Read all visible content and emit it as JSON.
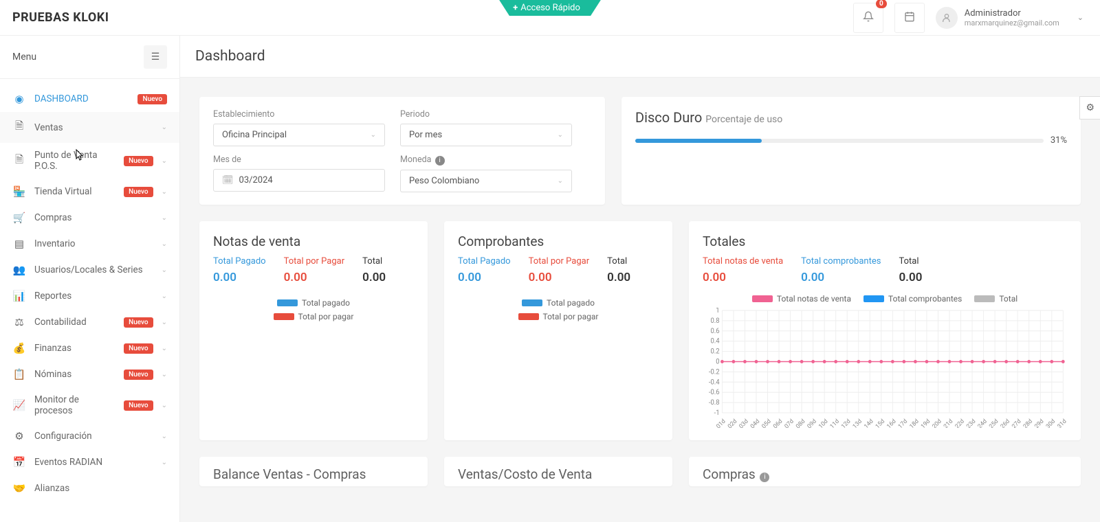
{
  "quick_access": "Acceso Rápido",
  "logo": "PRUEBAS KLOKI",
  "notifications_count": "0",
  "user": {
    "name": "Administrador",
    "email": "marxmarquinez@gmail.com"
  },
  "menu_label": "Menu",
  "page_title": "Dashboard",
  "badge_new": "Nuevo",
  "nav": {
    "dashboard": "DASHBOARD",
    "ventas": "Ventas",
    "pos": "Punto de Venta P.O.S.",
    "tienda": "Tienda Virtual",
    "compras": "Compras",
    "inventario": "Inventario",
    "usuarios": "Usuarios/Locales & Series",
    "reportes": "Reportes",
    "contabilidad": "Contabilidad",
    "finanzas": "Finanzas",
    "nominas": "Nóminas",
    "monitor": "Monitor de procesos",
    "config": "Configuración",
    "radian": "Eventos RADIAN",
    "alianzas": "Alianzas"
  },
  "filters": {
    "establecimiento_label": "Establecimiento",
    "establecimiento_value": "Oficina Principal",
    "periodo_label": "Periodo",
    "periodo_value": "Por mes",
    "mes_label": "Mes de",
    "mes_value": "03/2024",
    "moneda_label": "Moneda",
    "moneda_value": "Peso Colombiano"
  },
  "disk": {
    "title": "Disco Duro",
    "subtitle": "Porcentaje de uso",
    "percent": 31,
    "percent_label": "31%"
  },
  "notas": {
    "title": "Notas de venta",
    "pagado_label": "Total Pagado",
    "pagado_value": "0.00",
    "porpagar_label": "Total por Pagar",
    "porpagar_value": "0.00",
    "total_label": "Total",
    "total_value": "0.00",
    "legend_pagado": "Total pagado",
    "legend_porpagar": "Total por pagar"
  },
  "comprobantes": {
    "title": "Comprobantes",
    "pagado_label": "Total Pagado",
    "pagado_value": "0.00",
    "porpagar_label": "Total por Pagar",
    "porpagar_value": "0.00",
    "total_label": "Total",
    "total_value": "0.00",
    "legend_pagado": "Total pagado",
    "legend_porpagar": "Total por pagar"
  },
  "totales": {
    "title": "Totales",
    "notas_label": "Total notas de venta",
    "notas_value": "0.00",
    "comp_label": "Total comprobantes",
    "comp_value": "0.00",
    "total_label": "Total",
    "total_value": "0.00",
    "legend_notas": "Total notas de venta",
    "legend_comp": "Total comprobantes",
    "legend_total": "Total"
  },
  "peek": {
    "balance": "Balance Ventas - Compras",
    "ventas_costo": "Ventas/Costo de Venta",
    "compras": "Compras"
  },
  "chart_data": {
    "type": "line",
    "title": "Totales",
    "ylabel": "",
    "xlabel": "",
    "ylim": [
      -1.0,
      1.0
    ],
    "y_ticks": [
      1.0,
      0.8,
      0.6,
      0.4,
      0.2,
      0,
      -0.2,
      -0.4,
      -0.6,
      -0.8,
      -1.0
    ],
    "categories": [
      "01d",
      "02d",
      "03d",
      "04d",
      "05d",
      "06d",
      "07d",
      "08d",
      "09d",
      "10d",
      "11d",
      "12d",
      "13d",
      "14d",
      "15d",
      "16d",
      "17d",
      "18d",
      "19d",
      "20d",
      "21d",
      "22d",
      "23d",
      "24d",
      "25d",
      "26d",
      "27d",
      "28d",
      "29d",
      "30d",
      "31d"
    ],
    "series": [
      {
        "name": "Total notas de venta",
        "color": "#f06292",
        "values": [
          0,
          0,
          0,
          0,
          0,
          0,
          0,
          0,
          0,
          0,
          0,
          0,
          0,
          0,
          0,
          0,
          0,
          0,
          0,
          0,
          0,
          0,
          0,
          0,
          0,
          0,
          0,
          0,
          0,
          0,
          0
        ]
      },
      {
        "name": "Total comprobantes",
        "color": "#2196f3",
        "values": [
          0,
          0,
          0,
          0,
          0,
          0,
          0,
          0,
          0,
          0,
          0,
          0,
          0,
          0,
          0,
          0,
          0,
          0,
          0,
          0,
          0,
          0,
          0,
          0,
          0,
          0,
          0,
          0,
          0,
          0,
          0
        ]
      },
      {
        "name": "Total",
        "color": "#bbb",
        "values": [
          0,
          0,
          0,
          0,
          0,
          0,
          0,
          0,
          0,
          0,
          0,
          0,
          0,
          0,
          0,
          0,
          0,
          0,
          0,
          0,
          0,
          0,
          0,
          0,
          0,
          0,
          0,
          0,
          0,
          0,
          0
        ]
      }
    ]
  }
}
